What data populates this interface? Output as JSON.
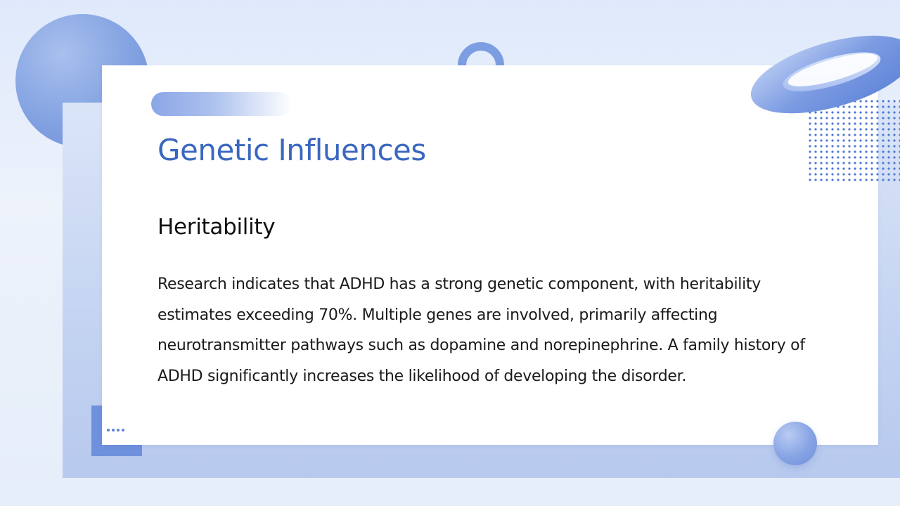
{
  "slide": {
    "title": "Genetic Influences",
    "section_heading": "Heritability",
    "body": "Research indicates that ADHD has a strong genetic component, with heritability estimates exceeding 70%. Multiple genes are involved, primarily affecting neurotransmitter pathways such as dopamine and norepinephrine. A family history of ADHD significantly increases the likelihood of developing the disorder."
  },
  "colors": {
    "accent": "#3a67c0",
    "decoration": "#7d9de3",
    "text": "#1a1a1a"
  },
  "decorations": [
    "circle-shape",
    "ring-shape",
    "ring-3d-shape",
    "dot-grid",
    "sphere-shape",
    "corner-bracket"
  ]
}
